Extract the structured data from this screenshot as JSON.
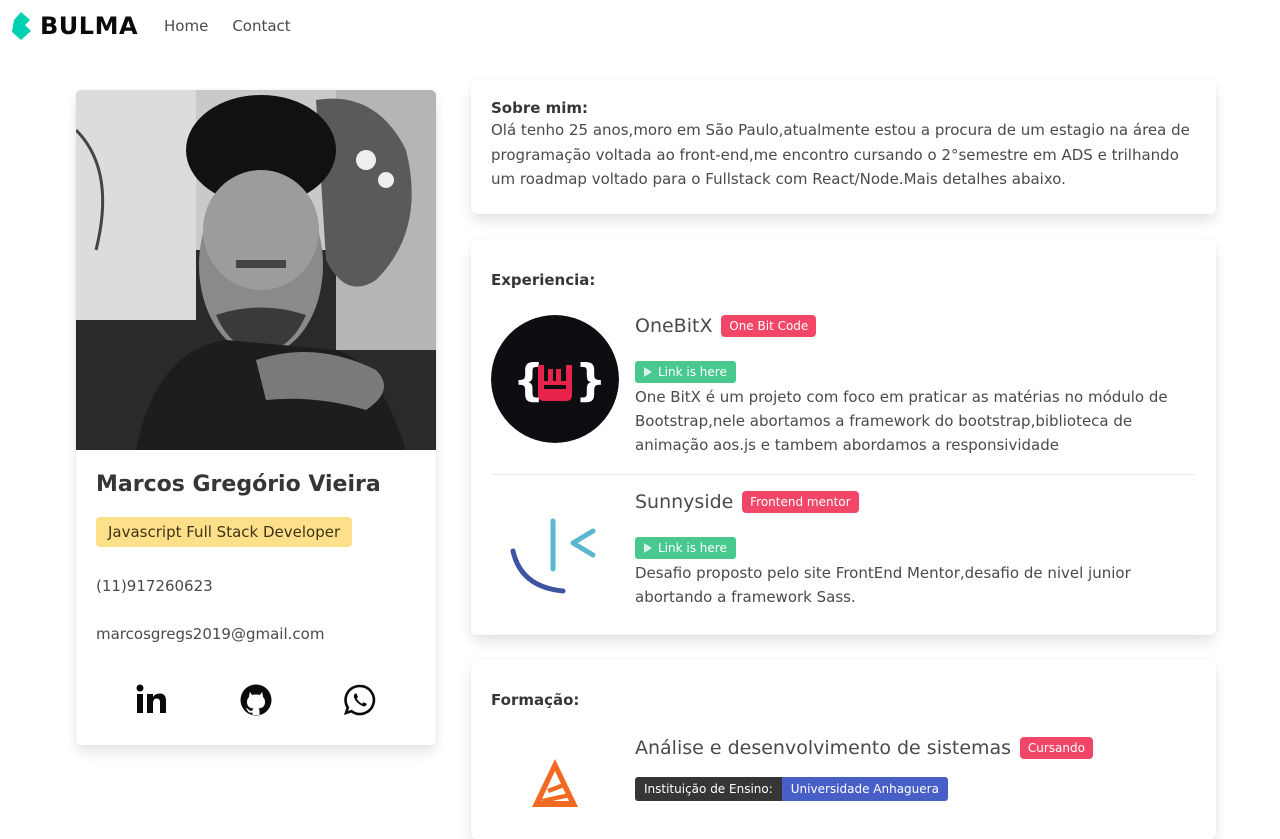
{
  "navbar": {
    "brand": "BULMA",
    "links": [
      "Home",
      "Contact"
    ]
  },
  "profile": {
    "name": "Marcos Gregório Vieira",
    "role": "Javascript Full Stack Developer",
    "phone": "(11)917260623",
    "email": "marcosgregs2019@gmail.com",
    "social_icons": [
      "linkedin-icon",
      "github-icon",
      "whatsapp-icon"
    ]
  },
  "about": {
    "title": "Sobre mim:",
    "text": "Olá tenho 25 anos,moro em São Paulo,atualmente estou a procura de um estagio na área de programação voltada ao front-end,me encontro cursando o 2°semestre em ADS e trilhando um roadmap voltado para o Fullstack com React/Node.Mais detalhes abaixo."
  },
  "experience": {
    "title": "Experiencia:",
    "items": [
      {
        "name": "OneBitX",
        "tag": "One Bit Code",
        "link_label": "Link is here",
        "description": "One BitX é um projeto com foco em praticar as matérias no módulo de Bootstrap,nele abortamos a framework do bootstrap,biblioteca de animação aos.js e tambem abordamos a responsividade"
      },
      {
        "name": "Sunnyside",
        "tag": "Frontend mentor",
        "link_label": "Link is here",
        "description": "Desafio proposto pelo site FrontEnd Mentor,desafio de nivel junior abortando a framework Sass."
      }
    ]
  },
  "education": {
    "title": "Formação:",
    "items": [
      {
        "course": "Análise e desenvolvimento de sistemas",
        "status": "Cursando",
        "institution_label": "Instituição de Ensino:",
        "institution": "Universidade Anhaguera"
      }
    ]
  },
  "colors": {
    "brand": "#00d1b2",
    "warning": "#ffe08a",
    "danger": "#f14668",
    "success": "#48c78e",
    "link": "#485fc7",
    "dark": "#363636"
  }
}
